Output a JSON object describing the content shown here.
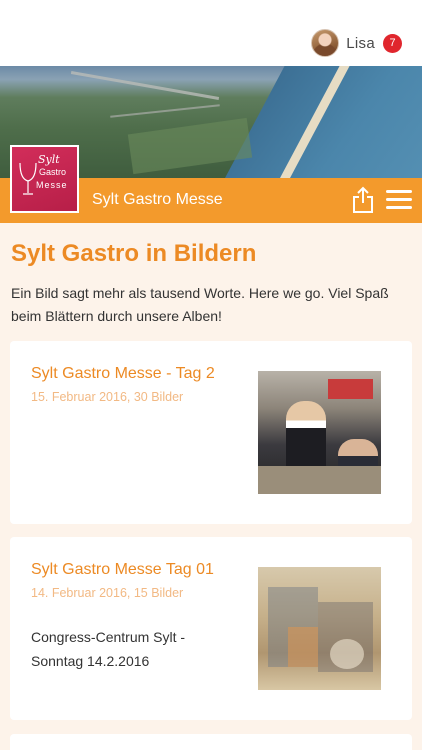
{
  "user": {
    "name": "Lisa",
    "notification_count": "7"
  },
  "header": {
    "title": "Sylt Gastro Messe",
    "logo_lines": [
      "Sylt",
      "Gastro",
      "Messe"
    ]
  },
  "page": {
    "title": "Sylt Gastro in Bildern",
    "intro": "Ein Bild sagt mehr als tausend Worte. Here we go. Viel Spaß beim Blättern durch unsere Alben!"
  },
  "albums": [
    {
      "title": "Sylt Gastro Messe - Tag 2",
      "meta": "15. Februar 2016, 30 Bilder",
      "description": ""
    },
    {
      "title": "Sylt Gastro Messe Tag 01",
      "meta": "14. Februar 2016, 15 Bilder",
      "description": "Congress-Centrum Sylt - Sonntag 14.2.2016"
    }
  ],
  "colors": {
    "accent": "#f39a2c",
    "title_orange": "#ec8a24",
    "badge_red": "#e0262d",
    "background": "#fdf3ea"
  },
  "icons": {
    "share": "share-icon",
    "menu": "hamburger-menu-icon"
  }
}
